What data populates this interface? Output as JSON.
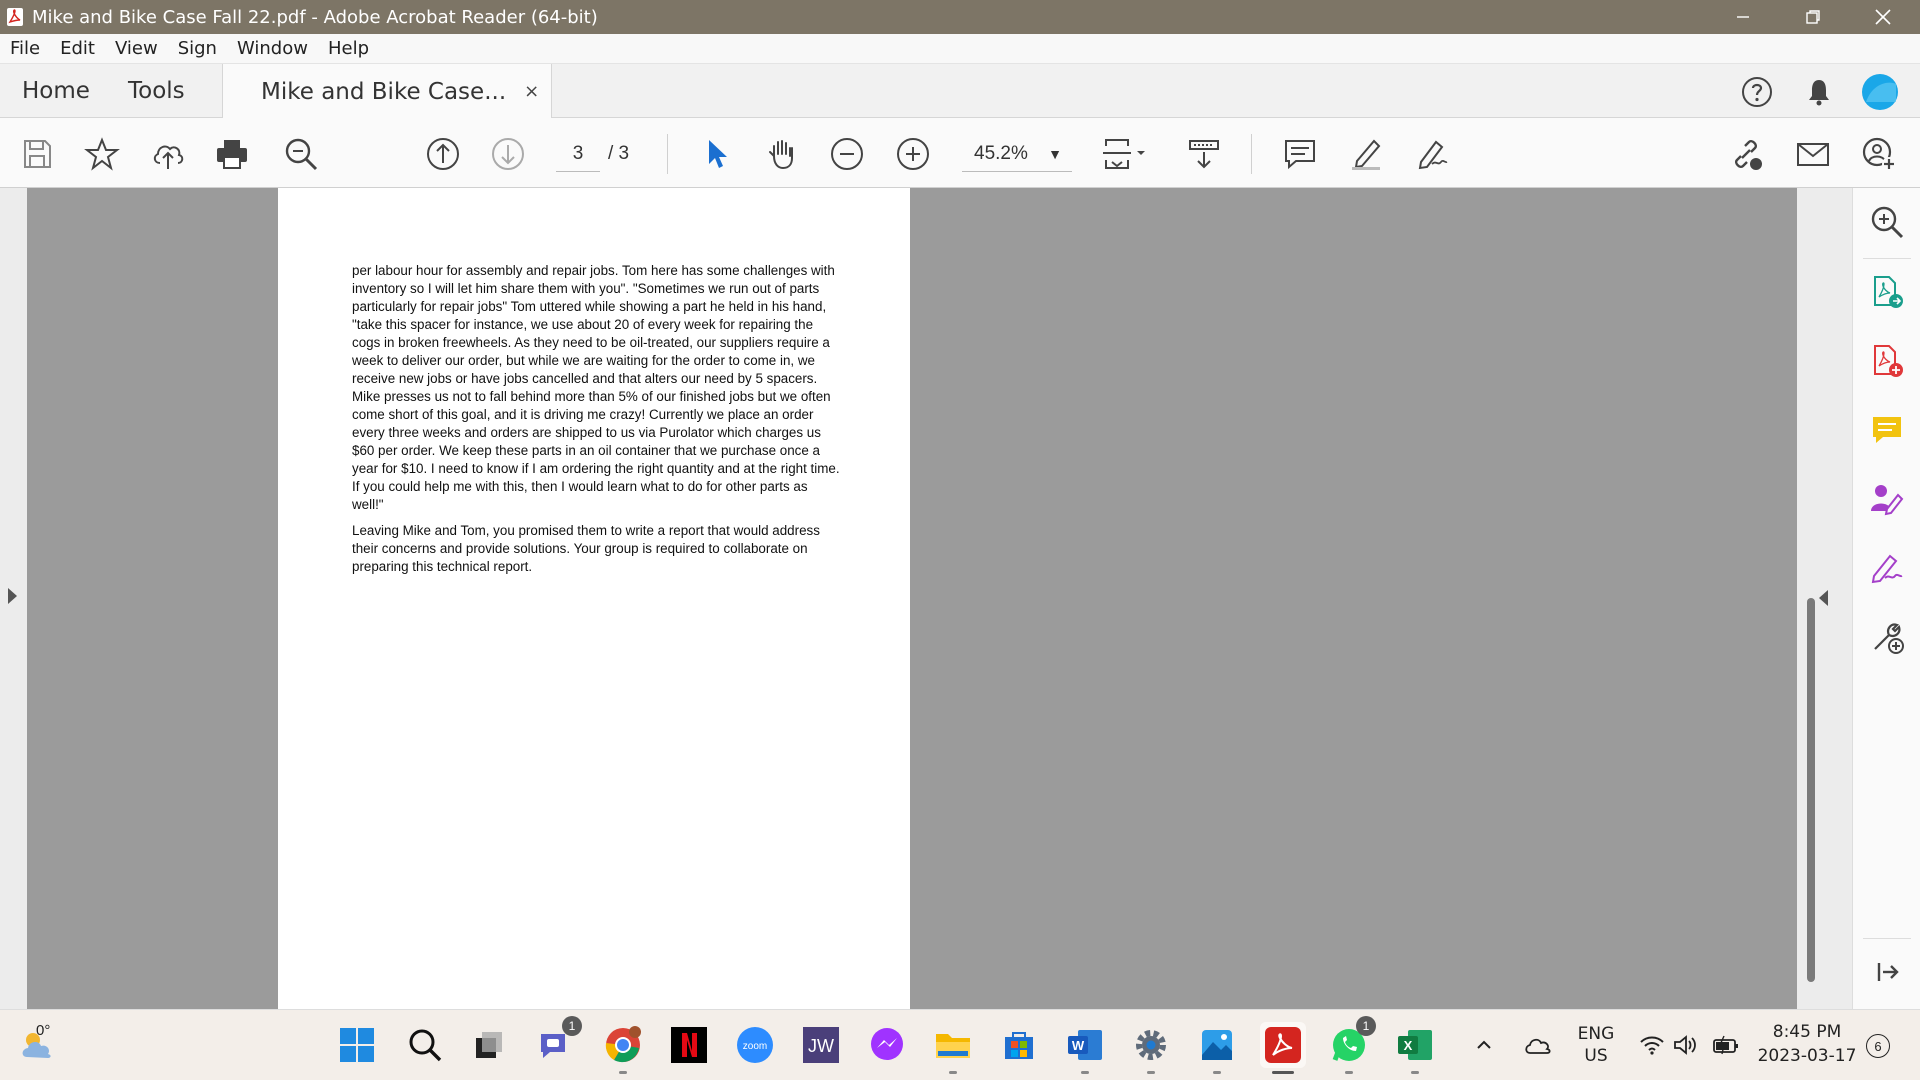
{
  "window": {
    "title": "Mike and Bike Case Fall 22.pdf - Adobe Acrobat Reader (64-bit)",
    "accent": "#7d7566"
  },
  "menu": [
    "File",
    "Edit",
    "View",
    "Sign",
    "Window",
    "Help"
  ],
  "tabs": {
    "home": "Home",
    "tools": "Tools",
    "document": "Mike and Bike Case...",
    "close": "×"
  },
  "toolbar": {
    "page_current": "3",
    "page_total": "/ 3",
    "zoom": "45.2%"
  },
  "document": {
    "paragraphs": [
      "per labour hour for assembly and repair jobs. Tom here has some challenges with inventory so I will let him share them with you\". \"Sometimes we run out of parts particularly for repair jobs\" Tom uttered while showing a part he held in his hand, \"take this spacer for instance, we use about 20 of every week for repairing the cogs in broken freewheels. As they need to be oil-treated, our suppliers require a week to deliver our order, but while we are waiting for the order to come in, we receive new jobs or have jobs cancelled and that alters our need by 5 spacers. Mike presses us not to fall behind more than 5% of our finished jobs but we often come short of this goal, and it is driving me crazy! Currently we place an order every three weeks and orders are shipped to us via Purolator which charges us $60 per order. We keep these parts in an oil container that we purchase once a year for $10. I need to know if I am ordering the right quantity and at the right time. If you could help me with this, then I would learn what to do for other parts as well!\"",
      "Leaving Mike and Tom, you promised them to write a report that would address their concerns and provide solutions. Your group is required to collaborate on preparing this technical report."
    ]
  },
  "taskbar": {
    "weather": "0°",
    "teams_badge": "1",
    "whatsapp_badge": "1",
    "language_line1": "ENG",
    "language_line2": "US",
    "time": "8:45 PM",
    "date": "2023-03-17",
    "notifications": "6"
  }
}
